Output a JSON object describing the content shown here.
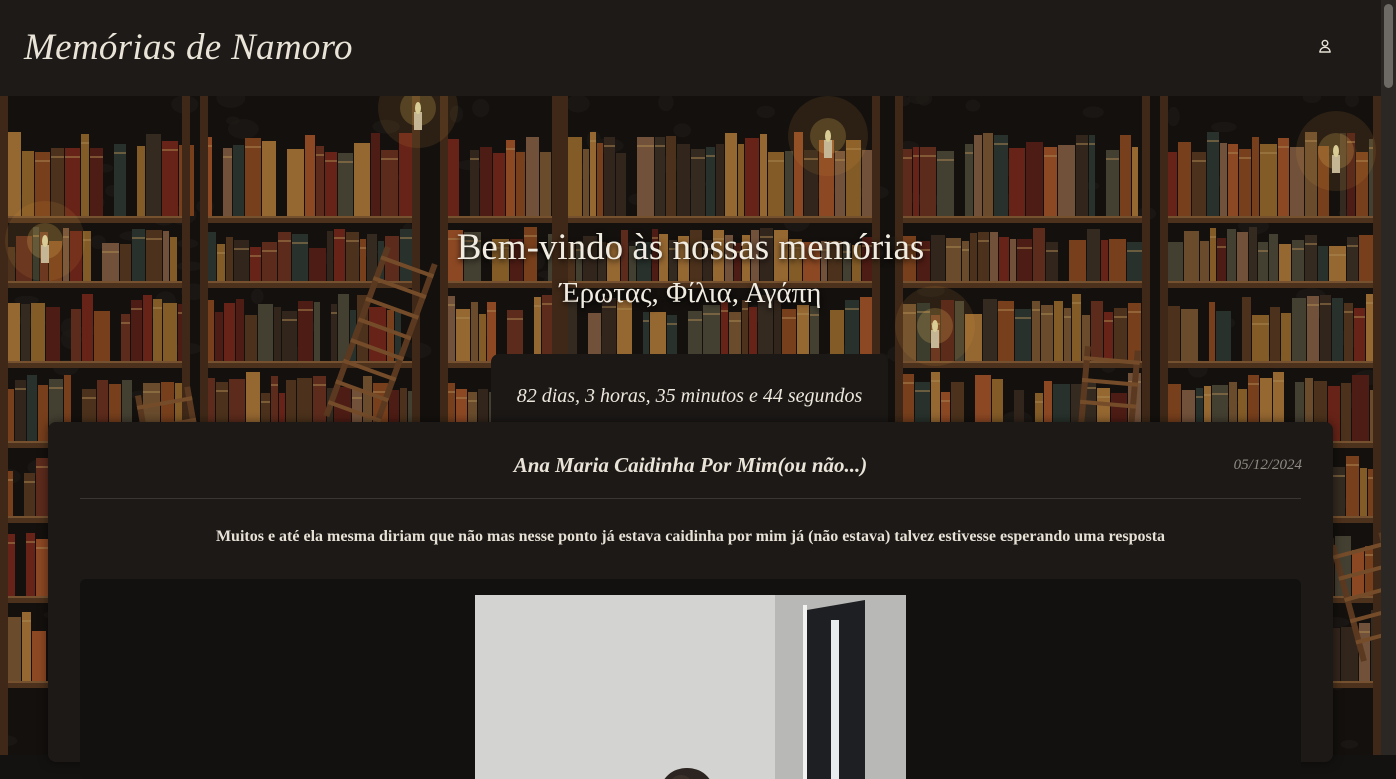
{
  "header": {
    "site_title": "Memórias de Namoro",
    "user_icon": "user-icon"
  },
  "hero": {
    "title": "Bem-vindo às nossas memórias",
    "subtitle": "Έρωτας, Φίλια, Αγάπη",
    "counter": "82 dias, 3 horas, 35 minutos e 44 segundos",
    "background": "library-bookshelves-image"
  },
  "post": {
    "title": "Ana Maria Caidinha Por Mim(ou não...)",
    "date": "05/12/2024",
    "text": "Muitos e até ela mesma diriam que não mas nesse ponto já estava caidinha por mim já (não estava) talvez estivesse esperando uma resposta",
    "photo": "post-photo"
  },
  "colors": {
    "header_bg": "#1d1a18",
    "card_bg": "#1c1917",
    "text": "#e8e2d6",
    "date": "#8f8a82"
  }
}
